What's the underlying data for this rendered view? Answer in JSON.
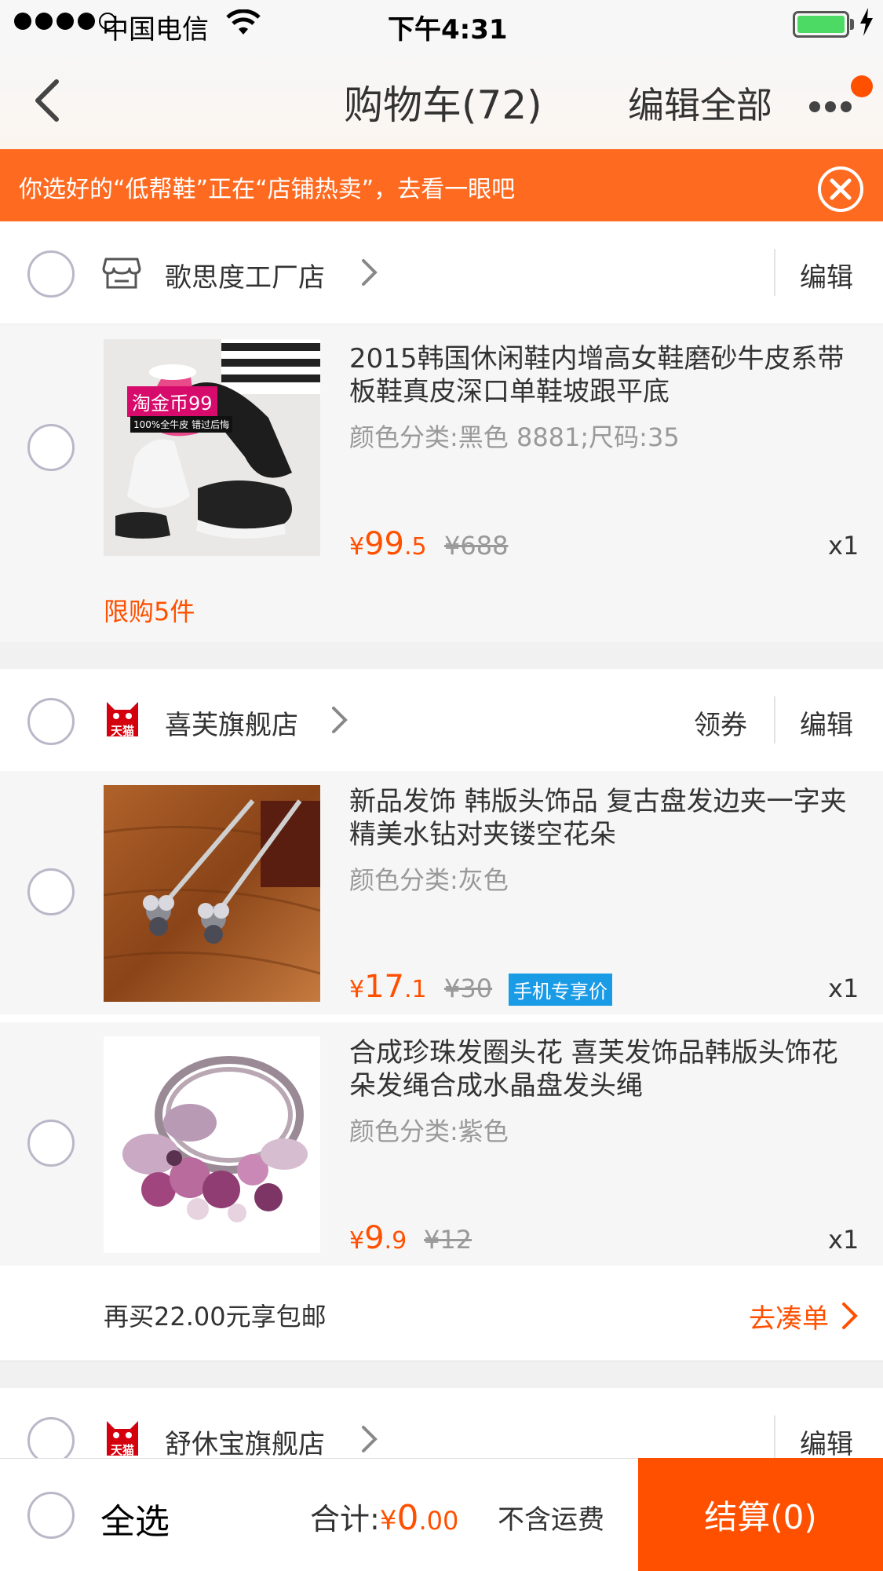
{
  "status": {
    "carrier": "中国电信",
    "time": "下午4:31"
  },
  "nav": {
    "title": "购物车(72)",
    "edit_all": "编辑全部"
  },
  "banner": {
    "text": "你选好的“低帮鞋”正在“店铺热卖”，去看一眼吧"
  },
  "shops": [
    {
      "name": "歌思度工厂店",
      "edit": "编辑",
      "items": [
        {
          "title": "2015韩国休闲鞋内增高女鞋磨砂牛皮系带板鞋真皮深口单鞋坡跟平底",
          "sku": "颜色分类:黑色 8881;尺码:35",
          "price_symbol": "¥",
          "price_int": "99",
          "price_dec": ".5",
          "orig_price": "¥688",
          "qty": "x1",
          "thumb_badge": "淘金币99",
          "thumb_badge2": "100%全牛皮 错过后悔"
        }
      ],
      "limit": "限购5件"
    },
    {
      "name": "喜芙旗舰店",
      "coupon": "领券",
      "edit": "编辑",
      "tmall_label": "天猫",
      "items": [
        {
          "title": "新品发饰 韩版头饰品 复古盘发边夹一字夹 精美水钻对夹镂空花朵",
          "sku": "颜色分类:灰色",
          "price_symbol": "¥",
          "price_int": "17",
          "price_dec": ".1",
          "orig_price": "¥30",
          "tag": "手机专享价",
          "qty": "x1"
        },
        {
          "title": "合成珍珠发圈头花 喜芙发饰品韩版头饰花朵发绳合成水晶盘发头绳",
          "sku": "颜色分类:紫色",
          "price_symbol": "¥",
          "price_int": "9",
          "price_dec": ".9",
          "orig_price": "¥12",
          "qty": "x1"
        }
      ],
      "free_ship_text": "再买22.00元享包邮",
      "free_ship_link": "去凑单"
    },
    {
      "name": "舒休宝旗舰店",
      "edit": "编辑",
      "tmall_label": "天猫"
    }
  ],
  "bottom": {
    "select_all": "全选",
    "total_label": "合计:",
    "total_symbol": "¥",
    "total_int": "0",
    "total_dec": ".00",
    "shipping": "不含运费",
    "checkout": "结算(0)"
  },
  "colors": {
    "accent": "#ff5000",
    "banner": "#ff6a21",
    "tag_blue": "#1a9be6"
  }
}
